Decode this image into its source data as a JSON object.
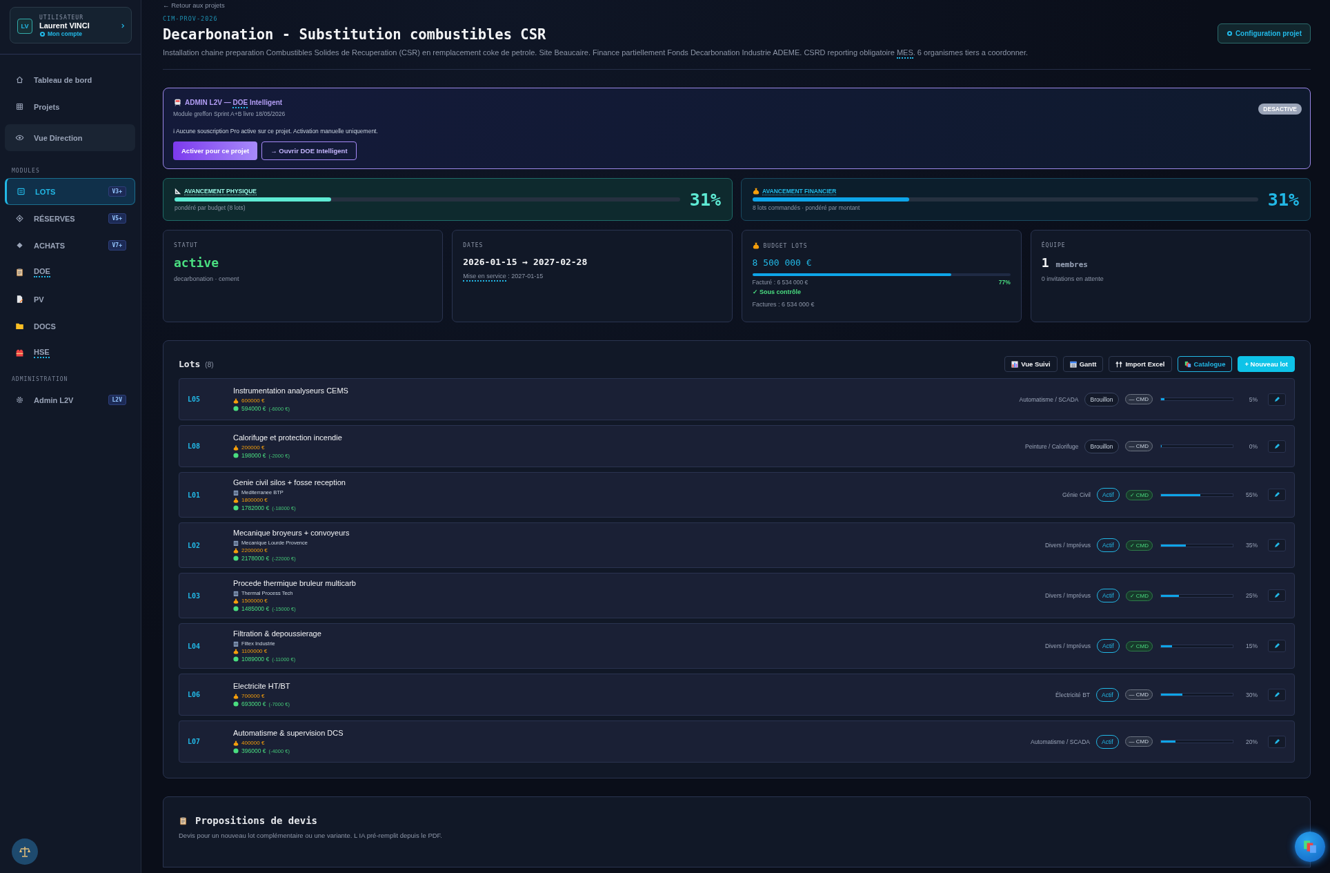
{
  "sidebar": {
    "user": {
      "initials": "LV",
      "label": "UTILISATEUR",
      "name": "Laurent VINCI",
      "link": "Mon compte"
    },
    "top_items": [
      {
        "label": "Tableau de bord",
        "selected": false,
        "highlighted": false
      },
      {
        "label": "Projets",
        "selected": false,
        "highlighted": false
      },
      {
        "label": "Vue Direction",
        "selected": false,
        "highlighted": true
      }
    ],
    "sections": [
      {
        "heading": "MODULES",
        "items": [
          {
            "label": "LOTS",
            "badge": "V3+",
            "selected": true,
            "abbr": false
          },
          {
            "label": "RÉSERVES",
            "badge": "V5+",
            "selected": false,
            "abbr": false
          },
          {
            "label": "ACHATS",
            "badge": "V7+",
            "selected": false,
            "abbr": false
          },
          {
            "label": "DOE",
            "selected": false,
            "abbr": true
          },
          {
            "label": "PV",
            "selected": false,
            "abbr": false
          },
          {
            "label": "DOCS",
            "selected": false,
            "abbr": false
          },
          {
            "label": "HSE",
            "selected": false,
            "abbr": true
          }
        ]
      },
      {
        "heading": "ADMINISTRATION",
        "items": [
          {
            "label": "Admin L2V",
            "badge": "L2V",
            "selected": false,
            "abbr": false
          }
        ]
      }
    ]
  },
  "header": {
    "back_link": "← Retour aux projets",
    "code": "CIM-PROV-2026",
    "title": "Decarbonation - Substitution combustibles CSR",
    "description": [
      {
        "text": "Installation chaine preparation Combustibles Solides de Recuperation (CSR) en remplacement coke de petrole. Site Beaucaire. Finance partiellement Fonds Decarbonation Industrie ADEME. CSRD reporting obligatoire ",
        "abbr": false
      },
      {
        "text": "MES",
        "abbr": true
      },
      {
        "text": ". 6 organismes tiers a coordonner.",
        "abbr": false
      }
    ],
    "config_button": "Configuration projet"
  },
  "admin_panel": {
    "title": [
      {
        "text": "ADMIN L2V — ",
        "abbr": false
      },
      {
        "text": "DOE",
        "abbr": true
      },
      {
        "text": " Intelligent",
        "abbr": false
      }
    ],
    "subtitle": "Module greffon Sprint A+B livre 18/05/2026",
    "status": "DESACTIVE",
    "active": false,
    "notice": "ℹ Aucune souscription Pro active sur ce projet. Activation manuelle uniquement.",
    "primary_button": "Activer pour ce projet",
    "secondary_button": "→ Ouvrir DOE Intelligent"
  },
  "progress": [
    {
      "kind": "physical",
      "title": "AVANCEMENT PHYSIQUE",
      "caption": "pondéré par budget (8 lots)",
      "level": 0.31,
      "value": "31%"
    },
    {
      "kind": "financial",
      "title": "AVANCEMENT FINANCIER",
      "caption": "8 lots commandés · pondéré par montant",
      "level": 0.31,
      "value": "31%"
    }
  ],
  "stats": [
    {
      "kind": "status",
      "label": "STATUT",
      "value": "active",
      "sub": "decarbonation · cement"
    },
    {
      "kind": "dates",
      "label": "DATES",
      "value": "2026-01-15 → 2027-02-28",
      "sub_label": "Mise en service",
      "sub": " : 2027-01-15"
    },
    {
      "kind": "budget",
      "label": "BUDGET LOTS",
      "value": "8 500 000 €",
      "level": 0.77,
      "percent": "77%",
      "invoiced": "Facturé : 6 534 000 €",
      "health": "✓ Sous contrôle",
      "invoices": "Factures : 6 534 000 €"
    },
    {
      "kind": "team",
      "label": "ÉQUIPE",
      "value": "1",
      "unit": "membres",
      "sub": "0 invitations en attente"
    }
  ],
  "lots": {
    "title": "Lots",
    "count": "(8)",
    "toolbar": [
      {
        "kind": "chart",
        "label": "Vue Suivi"
      },
      {
        "kind": "calendar",
        "label": "Gantt"
      },
      {
        "kind": "upload",
        "label": "Import Excel"
      },
      {
        "kind": "books",
        "label": "Catalogue"
      },
      {
        "kind": "add",
        "label": "+ Nouveau lot"
      }
    ],
    "rows": [
      {
        "code": "L05",
        "name": "Instrumentation analyseurs CEMS",
        "budget": "600000 €",
        "engaged": "594000 €",
        "delta": "(-6000 €)",
        "category": "Automatisme / SCADA",
        "status": "Brouillon",
        "active": false,
        "cmd": "— CMD",
        "ordered": false,
        "level": 0.05,
        "percent": "5%"
      },
      {
        "code": "L08",
        "name": "Calorifuge et protection incendie",
        "budget": "200000 €",
        "engaged": "198000 €",
        "delta": "(-2000 €)",
        "category": "Peinture / Calorifuge",
        "status": "Brouillon",
        "active": false,
        "cmd": "— CMD",
        "ordered": false,
        "level": 0,
        "percent": "0%"
      },
      {
        "code": "L01",
        "name": "Genie civil silos + fosse reception",
        "supplier": "Mediterranee BTP",
        "budget": "1800000 €",
        "engaged": "1782000 €",
        "delta": "(-18000 €)",
        "category": "Génie Civil",
        "status": "Actif",
        "active": true,
        "cmd": "✓ CMD",
        "ordered": true,
        "level": 0.55,
        "percent": "55%"
      },
      {
        "code": "L02",
        "name": "Mecanique broyeurs + convoyeurs",
        "supplier": "Mecanique Lourde Provence",
        "budget": "2200000 €",
        "engaged": "2178000 €",
        "delta": "(-22000 €)",
        "category": "Divers / Imprévus",
        "status": "Actif",
        "active": true,
        "cmd": "✓ CMD",
        "ordered": true,
        "level": 0.35,
        "percent": "35%"
      },
      {
        "code": "L03",
        "name": "Procede thermique bruleur multicarb",
        "supplier": "Thermal Process Tech",
        "budget": "1500000 €",
        "engaged": "1485000 €",
        "delta": "(-15000 €)",
        "category": "Divers / Imprévus",
        "status": "Actif",
        "active": true,
        "cmd": "✓ CMD",
        "ordered": true,
        "level": 0.25,
        "percent": "25%"
      },
      {
        "code": "L04",
        "name": "Filtration & depoussierage",
        "supplier": "Filtex Industrie",
        "budget": "1100000 €",
        "engaged": "1089000 €",
        "delta": "(-11000 €)",
        "category": "Divers / Imprévus",
        "status": "Actif",
        "active": true,
        "cmd": "✓ CMD",
        "ordered": true,
        "level": 0.15,
        "percent": "15%"
      },
      {
        "code": "L06",
        "name": "Electricite HT/BT",
        "budget": "700000 €",
        "engaged": "693000 €",
        "delta": "(-7000 €)",
        "category": "Électricité BT",
        "status": "Actif",
        "active": true,
        "cmd": "— CMD",
        "ordered": false,
        "level": 0.3,
        "percent": "30%"
      },
      {
        "code": "L07",
        "name": "Automatisme & supervision DCS",
        "budget": "400000 €",
        "engaged": "396000 €",
        "delta": "(-4000 €)",
        "category": "Automatisme / SCADA",
        "status": "Actif",
        "active": true,
        "cmd": "— CMD",
        "ordered": false,
        "level": 0.2,
        "percent": "20%"
      }
    ]
  },
  "quotes": {
    "title": "Propositions de devis",
    "description": "Devis pour un nouveau lot complémentaire ou une variante. L IA pré-remplit depuis le PDF."
  }
}
